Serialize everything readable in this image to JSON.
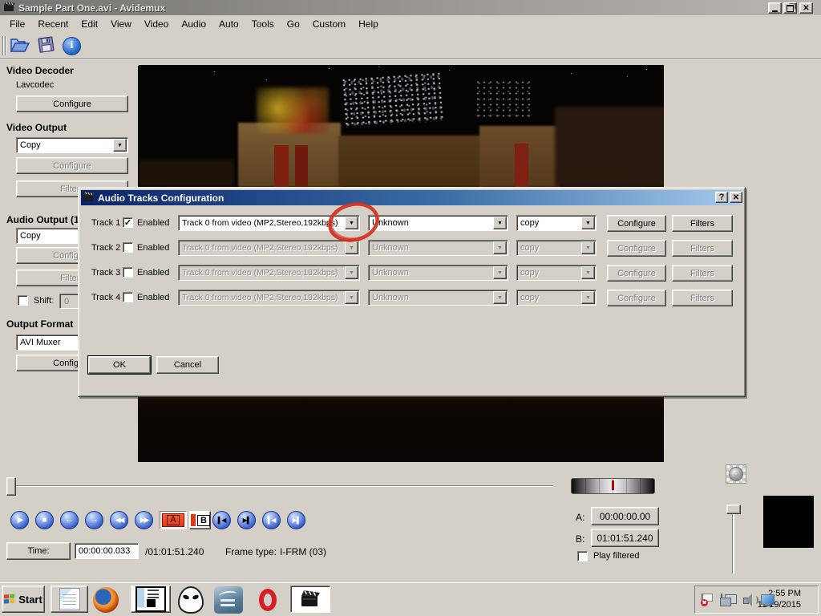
{
  "window": {
    "title": "Sample Part One.avi - Avidemux",
    "controls": [
      "minimize",
      "restore",
      "close"
    ]
  },
  "glyphs": {
    "check": "✓",
    "dropdown": "▼",
    "close": "✕",
    "help": "?",
    "info": "i",
    "play": "▶",
    "stop": "■",
    "prev": "←",
    "next": "→",
    "rewind": "◀◀",
    "fast_forward": "▶▶",
    "marker_a": "A",
    "marker_b": "B",
    "skip_back": "▌◀",
    "skip_fwd": "▶▌"
  },
  "menu": {
    "items": [
      "File",
      "Recent",
      "Edit",
      "View",
      "Video",
      "Audio",
      "Auto",
      "Tools",
      "Go",
      "Custom",
      "Help"
    ]
  },
  "toolbar": {
    "icons": [
      "open-file",
      "save-file",
      "information"
    ]
  },
  "sidebar": {
    "video_decoder": {
      "heading": "Video Decoder",
      "codec": "Lavcodec",
      "configure_label": "Configure"
    },
    "video_output": {
      "heading": "Video Output",
      "selected": "Copy",
      "configure_label": "Configure",
      "filters_label": "Filters"
    },
    "audio_output": {
      "heading": "Audio Output (1",
      "selected": "Copy",
      "configure_label": "Configure",
      "filters_label": "Filters",
      "shift_label": "Shift:",
      "shift_value": "0"
    },
    "output_format": {
      "heading": "Output Format",
      "selected": "AVI Muxer",
      "configure_label": "Configure"
    }
  },
  "dialog": {
    "title": "Audio Tracks Configuration",
    "annotation_color": "#cf2f1e",
    "tracks": [
      {
        "label": "Track 1",
        "enabled_label": "Enabled",
        "checked": true,
        "source": "Track 0 from video (MP2,Stereo,192kbps)",
        "codec": "Unknown",
        "mode": "copy",
        "configure_label": "Configure",
        "filters_label": "Filters"
      },
      {
        "label": "Track 2",
        "enabled_label": "Enabled",
        "checked": false,
        "source": "Track 0 from video (MP2,Stereo,192kbps)",
        "codec": "Unknown",
        "mode": "copy",
        "configure_label": "Configure",
        "filters_label": "Filters"
      },
      {
        "label": "Track 3",
        "enabled_label": "Enabled",
        "checked": false,
        "source": "Track 0 from video (MP2,Stereo,192kbps)",
        "codec": "Unknown",
        "mode": "copy",
        "configure_label": "Configure",
        "filters_label": "Filters"
      },
      {
        "label": "Track 4",
        "enabled_label": "Enabled",
        "checked": false,
        "source": "Track 0 from video (MP2,Stereo,192kbps)",
        "codec": "Unknown",
        "mode": "copy",
        "configure_label": "Configure",
        "filters_label": "Filters"
      }
    ],
    "ok_label": "OK",
    "cancel_label": "Cancel"
  },
  "transport": {
    "buttons": [
      "play",
      "stop",
      "previous-frame",
      "next-frame",
      "rewind",
      "fast-forward",
      "marker-a",
      "marker-b",
      "previous-black-frame",
      "next-black-frame",
      "previous-keyframe",
      "next-keyframe"
    ],
    "time_label": "Time:",
    "time_value": "00:00:00.033",
    "duration_label": "/01:01:51.240",
    "frame_type_label": "Frame type:",
    "frame_type_value": "I-FRM (03)"
  },
  "selection": {
    "a_label": "A:",
    "a_value": "00:00:00.00",
    "b_label": "B:",
    "b_value": "01:01:51.240",
    "play_filtered_label": "Play filtered"
  },
  "taskbar": {
    "start_label": "Start",
    "apps": [
      "notepad",
      "firefox",
      "file-manager",
      "foobar2000",
      "openoffice-writer",
      "opera",
      "avidemux"
    ],
    "tray_icons": [
      "security-alert",
      "network",
      "volume",
      "show-desktop"
    ],
    "clock_time": "2:55 PM",
    "clock_date": "11/19/2015"
  }
}
